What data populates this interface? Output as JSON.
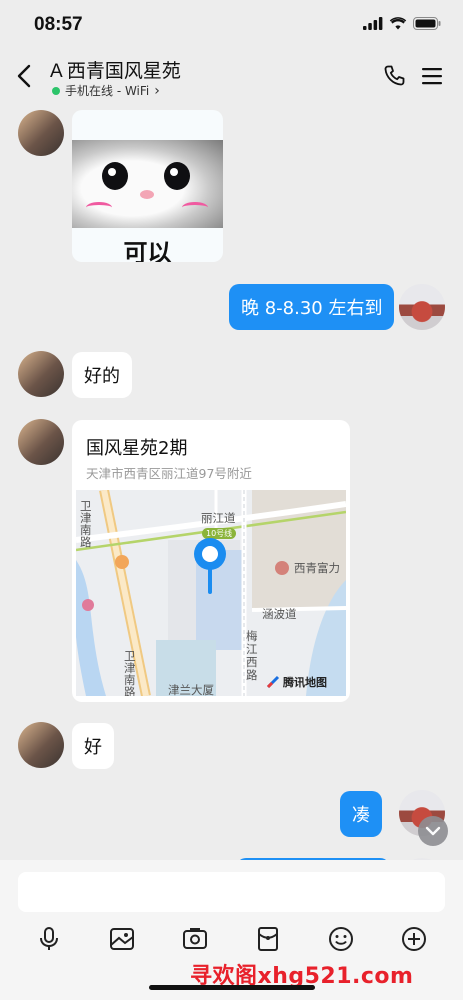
{
  "status_bar": {
    "time": "08:57"
  },
  "header": {
    "title": "A 西青国风星苑",
    "presence": "手机在线 - WiFi",
    "presence_arrow": "›"
  },
  "messages": {
    "sticker_text": "可以",
    "msg1": "晚 8-8.30 左右到",
    "msg2": "好的",
    "location": {
      "name": "国风星苑2期",
      "address": "天津市西青区丽江道97号附近",
      "map_labels": {
        "lijiang": "丽江道",
        "line10": "10号线",
        "xiqing": "西青富力",
        "hanbo": "涵波道",
        "meijiang": "梅江西路",
        "weijin": "卫津南路",
        "weijin2": "卫津南路",
        "jinlan": "津兰大厦",
        "brand": "腾讯地图"
      }
    },
    "msg3": "好",
    "msg4": "凑"
  },
  "input": {
    "placeholder": ""
  },
  "watermark": "寻欢阁xhg521.com"
}
